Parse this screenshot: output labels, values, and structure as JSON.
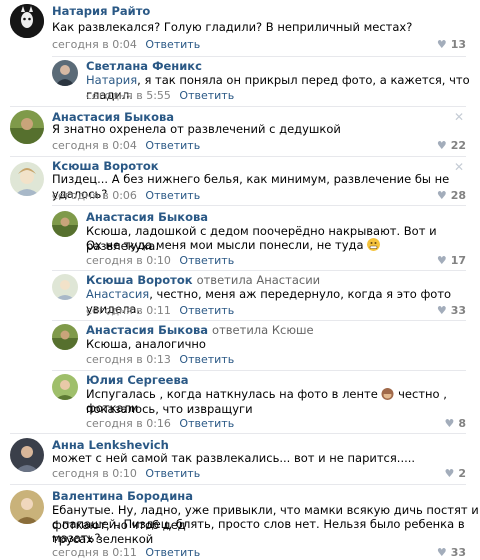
{
  "comments": [
    {
      "author": "Натария Райто",
      "text": "Как развлекался? Голую гладили? В неприличный местах?",
      "time": "сегодня в 0:04",
      "reply": "Ответить",
      "likes": "13"
    },
    {
      "author": "Светлана Феникс",
      "mention": "Натария",
      "text": ", я так поняла он прикрыл перед фото, а кажется, что гладил.",
      "time": "сегодня в 5:55",
      "reply": "Ответить"
    },
    {
      "author": "Анастасия Быкова",
      "text": "Я знатно охренела от развлечений с дедушкой",
      "time": "сегодня в 0:04",
      "reply": "Ответить",
      "likes": "22",
      "close": "✕"
    },
    {
      "author": "Ксюша Вороток",
      "text": "Пиздец... А без нижнего белья, как минимум, развлечение бы не удалось?",
      "time": "сегодня в 0:06",
      "reply": "Ответить",
      "likes": "28",
      "close": "✕"
    },
    {
      "author": "Анастасия Быкова",
      "text1": "Ксюша, ладошкой с дедом поочерёдно накрывают. Вот и развлекуха.",
      "text2": "Ох не туда меня мои мысли понесли, не туда",
      "time": "сегодня в 0:10",
      "reply": "Ответить",
      "likes": "17"
    },
    {
      "author": "Ксюша Вороток",
      "replied": "ответила Анастасии",
      "mention": "Анастасия",
      "text": ", честно, меня аж передернуло, когда я это фото увидела.",
      "time": "сегодня в 0:11",
      "reply": "Ответить",
      "likes": "33"
    },
    {
      "author": "Анастасия Быкова",
      "replied": "ответила Ксюше",
      "text": "Ксюша, аналогично",
      "time": "сегодня в 0:13",
      "reply": "Ответить"
    },
    {
      "author": "Юлия Сергеева",
      "text1": "Испугалась , когда наткнулась на фото в ленте",
      "text1b": "честно , показалось, что извращуги",
      "text2": "фоткали",
      "time": "сегодня в 0:16",
      "reply": "Ответить",
      "likes": "8"
    },
    {
      "author": "Анна Lenkshevich",
      "text": "может с ней самой так развлекались... вот и не парится.....",
      "time": "сегодня в 0:10",
      "reply": "Ответить",
      "likes": "2"
    },
    {
      "author": "Валентина Бородина",
      "text1": "Ебанутые. Ну, ладно, уже привыкли, что мамки всякую дичь постят и фоткают, но чтоб дед",
      "text2": "с папашей. Пиздец, блять, просто слов нет. Нельзя было ребенка в трусах зеленкой",
      "text3": "мазать?",
      "time": "сегодня в 0:11",
      "reply": "Ответить",
      "likes": "33"
    }
  ],
  "icons": {
    "heart": "♥"
  },
  "colors": {
    "author": "#2a5885",
    "meta": "#828282",
    "separator": "#e7e8ec"
  }
}
